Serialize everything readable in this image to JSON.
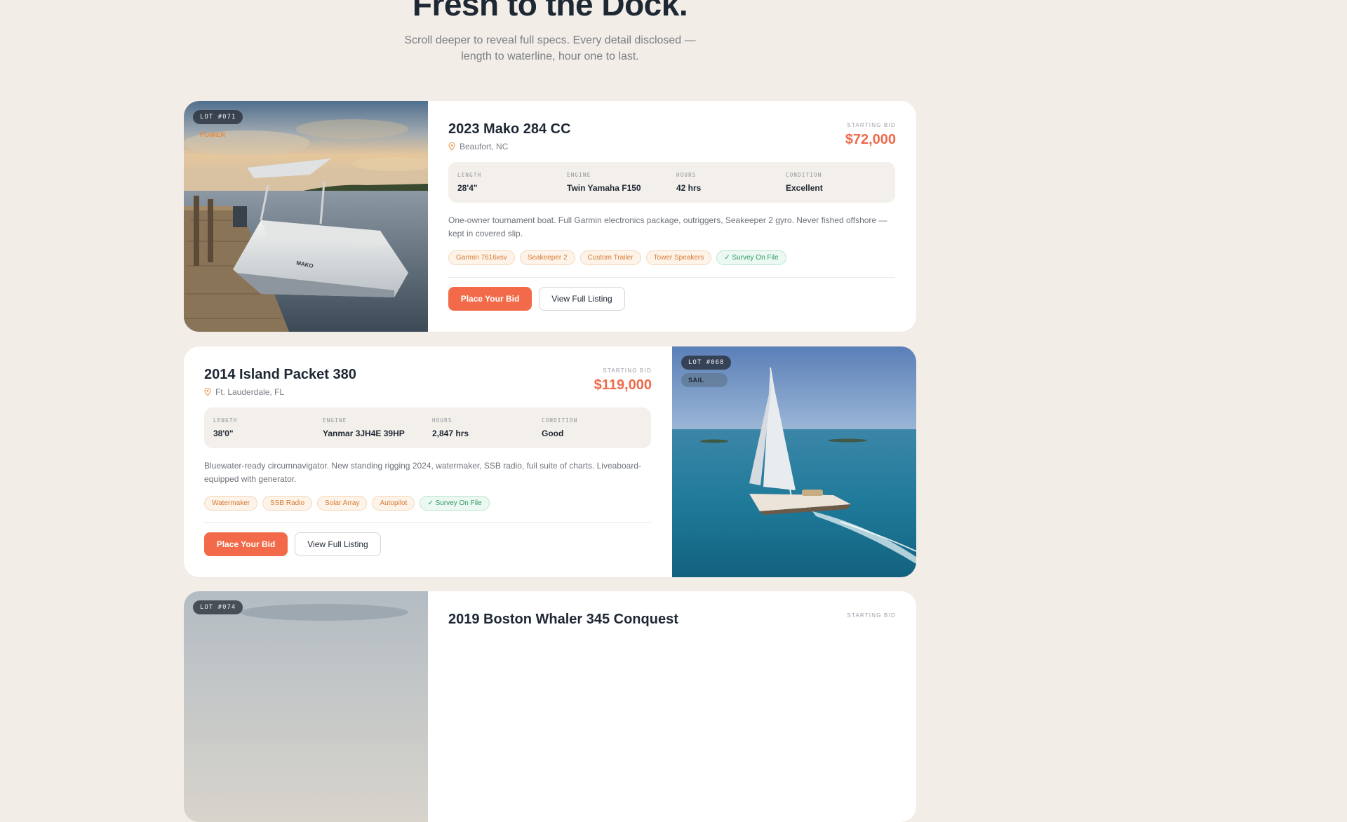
{
  "hero": {
    "title": "Fresh to the Dock.",
    "subtitle": "Scroll deeper to reveal full specs. Every detail disclosed — length to waterline, hour one to last."
  },
  "listings": [
    {
      "lot": "LOT #071",
      "type": "POWER",
      "title": "2023 Mako 284 CC",
      "location": "Beaufort, NC",
      "bid_label": "STARTING BID",
      "bid": "$72,000",
      "specs": [
        {
          "label": "LENGTH",
          "value": "28'4\""
        },
        {
          "label": "ENGINE",
          "value": "Twin Yamaha F150"
        },
        {
          "label": "HOURS",
          "value": "42 hrs"
        },
        {
          "label": "CONDITION",
          "value": "Excellent"
        }
      ],
      "description": "One-owner tournament boat. Full Garmin electronics package, outriggers, Seakeeper 2 gyro. Never fished offshore — kept in covered slip.",
      "tags": [
        "Garmin 7616xsv",
        "Seakeeper 2",
        "Custom Trailer",
        "Tower Speakers"
      ],
      "survey": "✓ Survey On File",
      "bid_button": "Place Your Bid",
      "view_button": "View Full Listing"
    },
    {
      "lot": "LOT #068",
      "type": "SAIL",
      "title": "2014 Island Packet 380",
      "location": "Ft. Lauderdale, FL",
      "bid_label": "STARTING BID",
      "bid": "$119,000",
      "specs": [
        {
          "label": "LENGTH",
          "value": "38'0\""
        },
        {
          "label": "ENGINE",
          "value": "Yanmar 3JH4E 39HP"
        },
        {
          "label": "HOURS",
          "value": "2,847 hrs"
        },
        {
          "label": "CONDITION",
          "value": "Good"
        }
      ],
      "description": "Bluewater-ready circumnavigator. New standing rigging 2024, watermaker, SSB radio, full suite of charts. Liveaboard-equipped with generator.",
      "tags": [
        "Watermaker",
        "SSB Radio",
        "Solar Array",
        "Autopilot"
      ],
      "survey": "✓ Survey On File",
      "bid_button": "Place Your Bid",
      "view_button": "View Full Listing"
    },
    {
      "lot": "LOT #074",
      "title": "2019 Boston Whaler 345 Conquest",
      "bid_label": "STARTING BID"
    }
  ],
  "colors": {
    "accent": "#f26a49",
    "price": "#ee6b4b",
    "background": "#f2ede7",
    "tag_text": "#d77a36",
    "survey_text": "#2f9a63"
  }
}
